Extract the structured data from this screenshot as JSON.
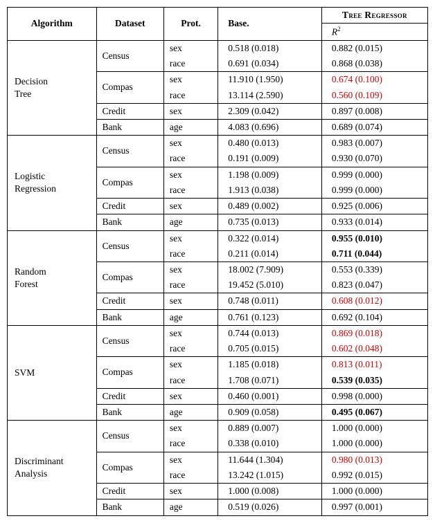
{
  "header": {
    "algorithm": "Algorithm",
    "dataset": "Dataset",
    "protocol": "Prot.",
    "base": "Base.",
    "tree_regressor": "Tree Regressor",
    "r2": "R",
    "r2_sup": "2"
  },
  "blocks": [
    {
      "algorithm": "Decision\nTree",
      "groups": [
        {
          "dataset": "Census",
          "rows": [
            {
              "prot": "sex",
              "base": "0.518 (0.018)",
              "r2": "0.882 (0.015)"
            },
            {
              "prot": "race",
              "base": "0.691 (0.034)",
              "r2": "0.868 (0.038)"
            }
          ]
        },
        {
          "dataset": "Compas",
          "rows": [
            {
              "prot": "sex",
              "base": "11.910 (1.950)",
              "r2": "0.674 (0.100)",
              "style": "red"
            },
            {
              "prot": "race",
              "base": "13.114 (2.590)",
              "r2": "0.560 (0.109)",
              "style": "red"
            }
          ]
        },
        {
          "dataset": "Credit",
          "rows": [
            {
              "prot": "sex",
              "base": "2.309 (0.042)",
              "r2": "0.897 (0.008)"
            }
          ]
        },
        {
          "dataset": "Bank",
          "rows": [
            {
              "prot": "age",
              "base": "4.083 (0.696)",
              "r2": "0.689 (0.074)"
            }
          ]
        }
      ]
    },
    {
      "algorithm": "Logistic\nRegression",
      "groups": [
        {
          "dataset": "Census",
          "rows": [
            {
              "prot": "sex",
              "base": "0.480 (0.013)",
              "r2": "0.983 (0.007)"
            },
            {
              "prot": "race",
              "base": "0.191 (0.009)",
              "r2": "0.930 (0.070)"
            }
          ]
        },
        {
          "dataset": "Compas",
          "rows": [
            {
              "prot": "sex",
              "base": "1.198 (0.009)",
              "r2": "0.999 (0.000)"
            },
            {
              "prot": "race",
              "base": "1.913 (0.038)",
              "r2": "0.999 (0.000)"
            }
          ]
        },
        {
          "dataset": "Credit",
          "rows": [
            {
              "prot": "sex",
              "base": "0.489 (0.002)",
              "r2": "0.925 (0.006)"
            }
          ]
        },
        {
          "dataset": "Bank",
          "rows": [
            {
              "prot": "age",
              "base": "0.735 (0.013)",
              "r2": "0.933 (0.014)"
            }
          ]
        }
      ]
    },
    {
      "algorithm": "Random\nForest",
      "groups": [
        {
          "dataset": "Census",
          "rows": [
            {
              "prot": "sex",
              "base": "0.322 (0.014)",
              "r2": "0.955 (0.010)",
              "style": "bold"
            },
            {
              "prot": "race",
              "base": "0.211 (0.014)",
              "r2": "0.711 (0.044)",
              "style": "bold"
            }
          ]
        },
        {
          "dataset": "Compas",
          "rows": [
            {
              "prot": "sex",
              "base": "18.002 (7.909)",
              "r2": "0.553 (0.339)"
            },
            {
              "prot": "race",
              "base": "19.452 (5.010)",
              "r2": "0.823 (0.047)"
            }
          ]
        },
        {
          "dataset": "Credit",
          "rows": [
            {
              "prot": "sex",
              "base": "0.748 (0.011)",
              "r2": "0.608 (0.012)",
              "style": "red"
            }
          ]
        },
        {
          "dataset": "Bank",
          "rows": [
            {
              "prot": "age",
              "base": "0.761 (0.123)",
              "r2": "0.692 (0.104)"
            }
          ]
        }
      ]
    },
    {
      "algorithm": "SVM",
      "groups": [
        {
          "dataset": "Census",
          "rows": [
            {
              "prot": "sex",
              "base": "0.744 (0.013)",
              "r2": "0.869 (0.018)",
              "style": "red"
            },
            {
              "prot": "race",
              "base": "0.705 (0.015)",
              "r2": "0.602 (0.048)",
              "style": "red"
            }
          ]
        },
        {
          "dataset": "Compas",
          "rows": [
            {
              "prot": "sex",
              "base": "1.185 (0.018)",
              "r2": "0.813 (0.011)",
              "style": "red"
            },
            {
              "prot": "race",
              "base": "1.708 (0.071)",
              "r2": "0.539 (0.035)",
              "style": "bold"
            }
          ]
        },
        {
          "dataset": "Credit",
          "rows": [
            {
              "prot": "sex",
              "base": "0.460 (0.001)",
              "r2": "0.998 (0.000)"
            }
          ]
        },
        {
          "dataset": "Bank",
          "rows": [
            {
              "prot": "age",
              "base": "0.909 (0.058)",
              "r2": "0.495 (0.067)",
              "style": "bold"
            }
          ]
        }
      ]
    },
    {
      "algorithm": "Discriminant\nAnalysis",
      "groups": [
        {
          "dataset": "Census",
          "rows": [
            {
              "prot": "sex",
              "base": "0.889 (0.007)",
              "r2": "1.000 (0.000)"
            },
            {
              "prot": "race",
              "base": "0.338 (0.010)",
              "r2": "1.000 (0.000)"
            }
          ]
        },
        {
          "dataset": "Compas",
          "rows": [
            {
              "prot": "sex",
              "base": "11.644 (1.304)",
              "r2": "0.980 (0.013)",
              "style": "red"
            },
            {
              "prot": "race",
              "base": "13.242 (1.015)",
              "r2": "0.992 (0.015)"
            }
          ]
        },
        {
          "dataset": "Credit",
          "rows": [
            {
              "prot": "sex",
              "base": "1.000 (0.008)",
              "r2": "1.000 (0.000)"
            }
          ]
        },
        {
          "dataset": "Bank",
          "rows": [
            {
              "prot": "age",
              "base": "0.519 (0.026)",
              "r2": "0.997 (0.001)"
            }
          ]
        }
      ]
    }
  ]
}
